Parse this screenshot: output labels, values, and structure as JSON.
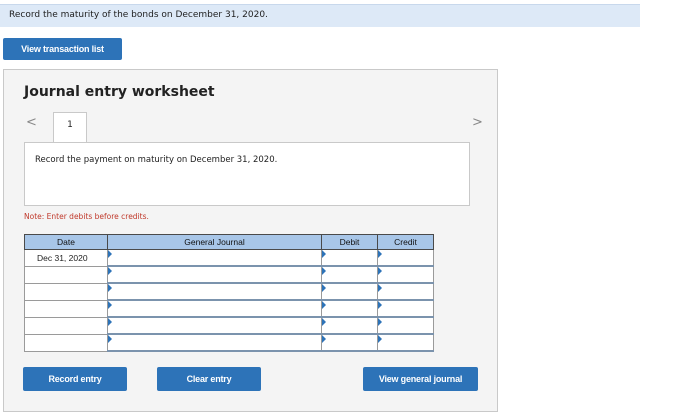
{
  "instruction": "Record the maturity of the bonds on December 31, 2020.",
  "buttons": {
    "view_transaction_list": "View transaction list",
    "record_entry": "Record entry",
    "clear_entry": "Clear entry",
    "view_general_journal": "View general journal"
  },
  "worksheet": {
    "title": "Journal entry worksheet",
    "prev_icon": "chevron-left-icon",
    "next_icon": "chevron-right-icon",
    "prev_glyph": "<",
    "next_glyph": ">",
    "tab_label": "1",
    "description": "Record the payment on maturity on December 31, 2020.",
    "note": "Note: Enter debits before credits."
  },
  "journal": {
    "headers": {
      "date": "Date",
      "general_journal": "General Journal",
      "debit": "Debit",
      "credit": "Credit"
    },
    "rows": [
      {
        "date": "Dec 31, 2020",
        "account": "",
        "debit": "",
        "credit": ""
      },
      {
        "date": "",
        "account": "",
        "debit": "",
        "credit": ""
      },
      {
        "date": "",
        "account": "",
        "debit": "",
        "credit": ""
      },
      {
        "date": "",
        "account": "",
        "debit": "",
        "credit": ""
      },
      {
        "date": "",
        "account": "",
        "debit": "",
        "credit": ""
      },
      {
        "date": "",
        "account": "",
        "debit": "",
        "credit": ""
      }
    ]
  },
  "colors": {
    "button_blue": "#2d73b8",
    "instruction_bg": "#dde9f7",
    "header_bg": "#a8c6e8",
    "note_red": "#c0392b"
  }
}
